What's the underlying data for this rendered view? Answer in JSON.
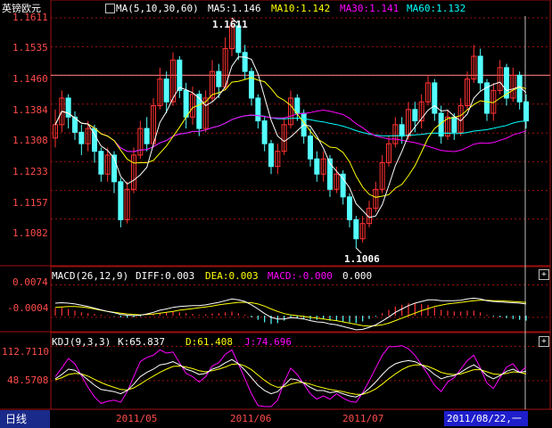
{
  "instrument": "英镑欧元",
  "period": "日线",
  "cursor_date": "2011/08/22,一",
  "price_panel": {
    "ma_label": "MA(5,10,30,60)",
    "ma5": "MA5:1.146",
    "ma10": "MA10:1.142",
    "ma30": "MA30:1.141",
    "ma60": "MA60:1.132",
    "high_label": "1.1611",
    "low_label": "1.1006",
    "y_ticks": [
      "1.1611",
      "1.1535",
      "1.1460",
      "1.1384",
      "1.1308",
      "1.1233",
      "1.1157",
      "1.1082"
    ]
  },
  "macd_panel": {
    "title": "MACD(26,12,9)",
    "diff": "DIFF:0.003",
    "dea": "DEA:0.003",
    "macd": "MACD:-0.000",
    "extra": "0.000",
    "y_ticks": [
      "0.0074",
      "-0.0004"
    ]
  },
  "kdj_panel": {
    "title": "KDJ(9,3,3)",
    "k": "K:65.837",
    "d": "D:61.408",
    "j": "J:74.696",
    "y_ticks": [
      "112.7110",
      "48.5708"
    ]
  },
  "x_labels": [
    "2011/05",
    "2011/06",
    "2011/07"
  ],
  "colors": {
    "up": "#ff3232",
    "down": "#54ffff",
    "ma5": "#ffffff",
    "ma10": "#ffff00",
    "ma30": "#ff00ff",
    "ma60": "#00ffff",
    "grid": "#a01010"
  },
  "chart_data": [
    {
      "type": "candlestick",
      "title": "英镑欧元",
      "ylim": [
        1.1006,
        1.1611
      ],
      "y_ticks": [
        1.1611,
        1.1535,
        1.146,
        1.1384,
        1.1308,
        1.1233,
        1.1157,
        1.1082
      ],
      "x_labels": [
        "2011/05",
        "2011/06",
        "2011/07"
      ],
      "legend": [
        "MA5:1.146",
        "MA10:1.142",
        "MA30:1.141",
        "MA60:1.132"
      ],
      "candles": [
        [
          1.1295,
          1.133,
          1.137,
          1.127
        ],
        [
          1.133,
          1.14,
          1.142,
          1.131
        ],
        [
          1.14,
          1.135,
          1.141,
          1.132
        ],
        [
          1.135,
          1.131,
          1.1365,
          1.129
        ],
        [
          1.131,
          1.128,
          1.133,
          1.125
        ],
        [
          1.128,
          1.132,
          1.134,
          1.126
        ],
        [
          1.132,
          1.126,
          1.133,
          1.123
        ],
        [
          1.126,
          1.12,
          1.127,
          1.118
        ],
        [
          1.12,
          1.125,
          1.127,
          1.118
        ],
        [
          1.125,
          1.118,
          1.126,
          1.115
        ],
        [
          1.118,
          1.108,
          1.119,
          1.106
        ],
        [
          1.108,
          1.116,
          1.118,
          1.107
        ],
        [
          1.116,
          1.125,
          1.127,
          1.115
        ],
        [
          1.125,
          1.132,
          1.134,
          1.124
        ],
        [
          1.132,
          1.128,
          1.135,
          1.126
        ],
        [
          1.128,
          1.138,
          1.14,
          1.127
        ],
        [
          1.138,
          1.145,
          1.148,
          1.137
        ],
        [
          1.145,
          1.139,
          1.147,
          1.136
        ],
        [
          1.139,
          1.15,
          1.152,
          1.138
        ],
        [
          1.15,
          1.142,
          1.151,
          1.14
        ],
        [
          1.142,
          1.135,
          1.144,
          1.132
        ],
        [
          1.135,
          1.141,
          1.143,
          1.133
        ],
        [
          1.141,
          1.132,
          1.142,
          1.13
        ],
        [
          1.132,
          1.14,
          1.142,
          1.131
        ],
        [
          1.14,
          1.147,
          1.15,
          1.139
        ],
        [
          1.147,
          1.143,
          1.149,
          1.14
        ],
        [
          1.143,
          1.153,
          1.156,
          1.142
        ],
        [
          1.153,
          1.159,
          1.1611,
          1.151
        ],
        [
          1.159,
          1.152,
          1.16,
          1.15
        ],
        [
          1.152,
          1.147,
          1.154,
          1.145
        ],
        [
          1.147,
          1.14,
          1.148,
          1.138
        ],
        [
          1.14,
          1.134,
          1.141,
          1.132
        ],
        [
          1.134,
          1.128,
          1.135,
          1.126
        ],
        [
          1.128,
          1.122,
          1.129,
          1.12
        ],
        [
          1.122,
          1.126,
          1.128,
          1.12
        ],
        [
          1.126,
          1.133,
          1.135,
          1.125
        ],
        [
          1.133,
          1.14,
          1.142,
          1.132
        ],
        [
          1.14,
          1.136,
          1.141,
          1.134
        ],
        [
          1.136,
          1.13,
          1.137,
          1.128
        ],
        [
          1.13,
          1.124,
          1.132,
          1.122
        ],
        [
          1.124,
          1.12,
          1.126,
          1.118
        ],
        [
          1.12,
          1.124,
          1.126,
          1.118
        ],
        [
          1.124,
          1.116,
          1.125,
          1.114
        ],
        [
          1.116,
          1.12,
          1.122,
          1.115
        ],
        [
          1.12,
          1.114,
          1.121,
          1.112
        ],
        [
          1.114,
          1.108,
          1.115,
          1.106
        ],
        [
          1.108,
          1.103,
          1.109,
          1.1006
        ],
        [
          1.103,
          1.107,
          1.109,
          1.102
        ],
        [
          1.107,
          1.111,
          1.113,
          1.106
        ],
        [
          1.111,
          1.116,
          1.118,
          1.11
        ],
        [
          1.116,
          1.123,
          1.125,
          1.115
        ],
        [
          1.123,
          1.128,
          1.13,
          1.122
        ],
        [
          1.128,
          1.133,
          1.135,
          1.127
        ],
        [
          1.133,
          1.13,
          1.135,
          1.128
        ],
        [
          1.13,
          1.137,
          1.139,
          1.129
        ],
        [
          1.137,
          1.134,
          1.139,
          1.131
        ],
        [
          1.134,
          1.139,
          1.141,
          1.132
        ],
        [
          1.139,
          1.144,
          1.146,
          1.138
        ],
        [
          1.144,
          1.136,
          1.145,
          1.134
        ],
        [
          1.136,
          1.13,
          1.138,
          1.128
        ],
        [
          1.13,
          1.135,
          1.137,
          1.129
        ],
        [
          1.135,
          1.131,
          1.136,
          1.129
        ],
        [
          1.131,
          1.138,
          1.14,
          1.13
        ],
        [
          1.138,
          1.145,
          1.147,
          1.137
        ],
        [
          1.145,
          1.151,
          1.154,
          1.144
        ],
        [
          1.151,
          1.144,
          1.153,
          1.142
        ],
        [
          1.144,
          1.136,
          1.145,
          1.134
        ],
        [
          1.136,
          1.142,
          1.144,
          1.134
        ],
        [
          1.142,
          1.148,
          1.15,
          1.141
        ],
        [
          1.148,
          1.14,
          1.149,
          1.138
        ],
        [
          1.14,
          1.146,
          1.148,
          1.139
        ],
        [
          1.146,
          1.139,
          1.147,
          1.137
        ],
        [
          1.139,
          1.134,
          1.141,
          1.132
        ]
      ],
      "ma5_last": 1.146,
      "ma10_last": 1.142,
      "ma30_last": 1.141,
      "ma60_last": 1.132
    },
    {
      "type": "bar",
      "title": "MACD(26,12,9)",
      "ylim": [
        -0.003,
        0.009
      ],
      "y_ticks": [
        0.0074,
        -0.0004
      ],
      "legend": [
        "DIFF:0.003",
        "DEA:0.003",
        "MACD:-0.000"
      ],
      "macd": [
        0.0018,
        0.002,
        0.0016,
        0.0012,
        0.0008,
        0.0006,
        0.0004,
        0.0002,
        0.0001,
        -0.0001,
        -0.0004,
        -0.0005,
        -0.0004,
        -0.0002,
        0.0001,
        0.0004,
        0.0007,
        0.0008,
        0.001,
        0.0008,
        0.0006,
        0.0004,
        0.0002,
        0.0003,
        0.0005,
        0.0006,
        0.0008,
        0.001,
        0.0006,
        0.0002,
        -0.0004,
        -0.001,
        -0.0016,
        -0.002,
        -0.0018,
        -0.0012,
        -0.0006,
        -0.0006,
        -0.0008,
        -0.001,
        -0.001,
        -0.0008,
        -0.0012,
        -0.0012,
        -0.0014,
        -0.0016,
        -0.0018,
        -0.0014,
        -0.0008,
        -0.0002,
        0.0006,
        0.0014,
        0.0022,
        0.0026,
        0.003,
        0.003,
        0.0028,
        0.0026,
        0.002,
        0.0014,
        0.0012,
        0.001,
        0.001,
        0.0012,
        0.0012,
        0.0008,
        0.0002,
        -0.0002,
        -0.0004,
        -0.0006,
        -0.0008,
        -0.001,
        -0.0012
      ],
      "diff": [
        0.003,
        0.0031,
        0.003,
        0.0028,
        0.0025,
        0.0022,
        0.0018,
        0.0014,
        0.001,
        0.0007,
        0.0003,
        0.0001,
        0.0,
        0.0001,
        0.0004,
        0.0008,
        0.0013,
        0.0016,
        0.002,
        0.0022,
        0.0023,
        0.0024,
        0.0024,
        0.0026,
        0.0029,
        0.0032,
        0.0036,
        0.004,
        0.0038,
        0.0034,
        0.0026,
        0.0016,
        0.0005,
        -0.0004,
        -0.0008,
        -0.0008,
        -0.0005,
        -0.0006,
        -0.0008,
        -0.0012,
        -0.0015,
        -0.0016,
        -0.002,
        -0.0022,
        -0.0026,
        -0.003,
        -0.0034,
        -0.0033,
        -0.0028,
        -0.0022,
        -0.0013,
        -0.0003,
        0.0008,
        0.0016,
        0.0024,
        0.003,
        0.0034,
        0.0038,
        0.0038,
        0.0036,
        0.0036,
        0.0036,
        0.0037,
        0.004,
        0.0042,
        0.004,
        0.0036,
        0.0034,
        0.0033,
        0.0032,
        0.0031,
        0.003,
        0.0028
      ],
      "dea": [
        0.002,
        0.0021,
        0.0022,
        0.0022,
        0.0021,
        0.0019,
        0.0016,
        0.0013,
        0.001,
        0.0008,
        0.0006,
        0.0004,
        0.0003,
        0.0002,
        0.0003,
        0.0004,
        0.0006,
        0.0008,
        0.001,
        0.0013,
        0.0015,
        0.0017,
        0.0019,
        0.0021,
        0.0023,
        0.0026,
        0.0028,
        0.003,
        0.0032,
        0.0032,
        0.0031,
        0.0028,
        0.0023,
        0.0016,
        0.001,
        0.0005,
        0.0002,
        0.0,
        -0.0002,
        -0.0004,
        -0.0006,
        -0.0008,
        -0.001,
        -0.0012,
        -0.0015,
        -0.0018,
        -0.0021,
        -0.0024,
        -0.0025,
        -0.0024,
        -0.0022,
        -0.0018,
        -0.0012,
        -0.0006,
        0.0,
        0.0006,
        0.0012,
        0.0017,
        0.0022,
        0.0025,
        0.0028,
        0.003,
        0.0032,
        0.0034,
        0.0036,
        0.0037,
        0.0037,
        0.0036,
        0.0036,
        0.0035,
        0.0034,
        0.0033,
        0.0032
      ]
    },
    {
      "type": "line",
      "title": "KDJ(9,3,3)",
      "ylim": [
        0,
        120
      ],
      "y_ticks": [
        112.711,
        48.5708
      ],
      "legend": [
        "K:65.837",
        "D:61.408",
        "J:74.696"
      ],
      "k": [
        52,
        60,
        70,
        68,
        60,
        50,
        40,
        32,
        30,
        28,
        24,
        30,
        42,
        56,
        64,
        70,
        78,
        80,
        84,
        78,
        70,
        66,
        60,
        62,
        70,
        74,
        82,
        88,
        80,
        68,
        54,
        40,
        30,
        24,
        28,
        40,
        52,
        50,
        44,
        36,
        30,
        30,
        26,
        28,
        24,
        20,
        18,
        24,
        34,
        46,
        60,
        72,
        80,
        84,
        86,
        84,
        78,
        70,
        60,
        52,
        56,
        58,
        64,
        72,
        78,
        70,
        58,
        52,
        58,
        66,
        70,
        64,
        66
      ],
      "d": [
        50,
        54,
        60,
        62,
        61,
        57,
        51,
        45,
        40,
        36,
        32,
        31,
        35,
        42,
        50,
        57,
        64,
        70,
        75,
        76,
        74,
        71,
        67,
        65,
        67,
        70,
        74,
        79,
        80,
        76,
        69,
        59,
        49,
        41,
        36,
        37,
        42,
        45,
        45,
        42,
        38,
        35,
        32,
        30,
        28,
        25,
        23,
        23,
        27,
        33,
        42,
        52,
        61,
        69,
        75,
        78,
        78,
        75,
        70,
        64,
        61,
        60,
        61,
        65,
        69,
        69,
        65,
        61,
        60,
        62,
        65,
        64,
        61
      ],
      "j": [
        56,
        72,
        90,
        80,
        58,
        36,
        18,
        6,
        10,
        12,
        8,
        28,
        56,
        84,
        92,
        96,
        106,
        100,
        102,
        82,
        62,
        56,
        46,
        56,
        76,
        82,
        98,
        106,
        80,
        52,
        24,
        2,
        -8,
        -10,
        12,
        46,
        72,
        60,
        42,
        24,
        14,
        20,
        14,
        24,
        16,
        10,
        8,
        26,
        48,
        72,
        96,
        112,
        112,
        114,
        108,
        96,
        78,
        60,
        40,
        28,
        46,
        54,
        70,
        86,
        96,
        72,
        44,
        34,
        54,
        74,
        80,
        64,
        74
      ]
    }
  ]
}
